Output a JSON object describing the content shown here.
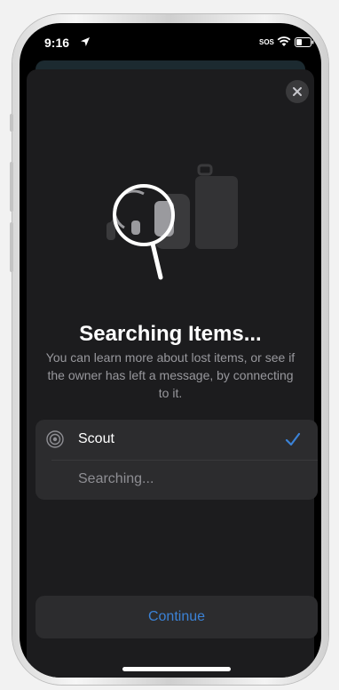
{
  "status_bar": {
    "time": "9:16",
    "carrier": "SOS",
    "location_icon": "location-arrow-icon",
    "wifi_icon": "wifi-icon",
    "battery_icon": "battery-icon"
  },
  "sheet": {
    "close_icon": "close-icon",
    "illustration": "magnifier-over-luggage-icon",
    "title": "Searching Items...",
    "description": "You can learn more about lost items, or see if the owner has left a message, by connecting to it."
  },
  "list": {
    "items": [
      {
        "icon": "radar-icon",
        "label": "Scout",
        "selected": true,
        "check_icon": "checkmark-icon"
      },
      {
        "label": "Searching..."
      }
    ]
  },
  "footer": {
    "continue_label": "Continue"
  },
  "colors": {
    "accent": "#3b82d6",
    "sheet_background": "#1c1c1e",
    "row_background": "#2c2c2e",
    "secondary_text": "#98989d"
  }
}
